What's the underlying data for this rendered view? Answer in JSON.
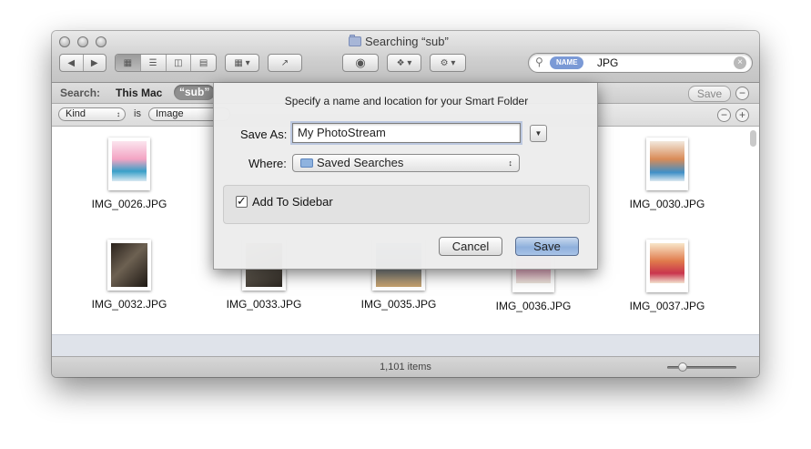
{
  "window": {
    "title": "Searching “sub”",
    "search_field": {
      "token": "NAME",
      "value": "JPG"
    }
  },
  "scope_bar": {
    "label": "Search:",
    "this_mac": "This Mac",
    "scope_sub": "“sub”",
    "save_button": "Save"
  },
  "criteria": {
    "attribute": "Kind",
    "operator": "is",
    "value": "Image"
  },
  "files": [
    {
      "name": "IMG_0026.JPG"
    },
    {
      "name": "IMG_0030.JPG"
    },
    {
      "name": "IMG_0032.JPG"
    },
    {
      "name": "IMG_0033.JPG"
    },
    {
      "name": "IMG_0035.JPG"
    },
    {
      "name": "IMG_0036.JPG"
    },
    {
      "name": "IMG_0037.JPG"
    }
  ],
  "status": {
    "item_count": "1,101 items"
  },
  "sheet": {
    "heading": "Specify a name and location for your Smart Folder",
    "save_as_label": "Save As:",
    "save_as_value": "My PhotoStream",
    "where_label": "Where:",
    "where_value": "Saved Searches",
    "add_to_sidebar_label": "Add To Sidebar",
    "add_to_sidebar_checked": true,
    "cancel_label": "Cancel",
    "save_label": "Save"
  }
}
